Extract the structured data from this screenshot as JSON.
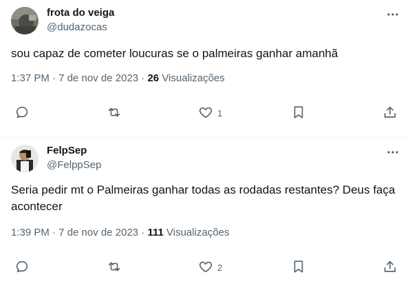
{
  "tweets": [
    {
      "name": "frota do veiga",
      "handle": "@dudazocas",
      "text": "sou capaz de cometer loucuras se o palmeiras ganhar amanhã",
      "time": "1:37 PM · 7 de nov de 2023 · ",
      "views_count": "26",
      "views_label": " Visualizações",
      "likes": "1"
    },
    {
      "name": "FelpSep",
      "handle": "@FelppSep",
      "text": "Seria pedir mt o Palmeiras ganhar todas as rodadas restantes? Deus faça acontecer",
      "time": "1:39 PM · 7 de nov de 2023 · ",
      "views_count": "111",
      "views_label": " Visualizações",
      "likes": "2"
    }
  ],
  "colors": {
    "text_primary": "#0f1419",
    "text_secondary": "#536471",
    "divider": "#eff3f4"
  },
  "icons": [
    "more-icon",
    "reply-icon",
    "retweet-icon",
    "like-icon",
    "bookmark-icon",
    "share-icon"
  ]
}
